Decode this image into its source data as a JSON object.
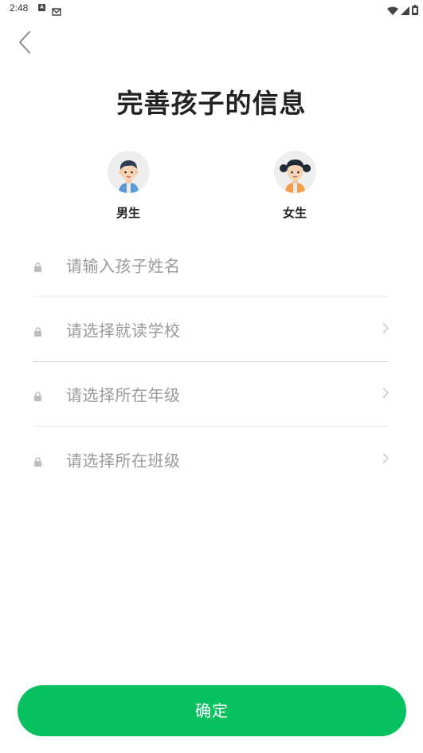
{
  "status_bar": {
    "time": "2:48",
    "badge_letter": "A",
    "icons": [
      "a-badge-icon",
      "mail-icon",
      "wifi-icon",
      "signal-icon",
      "battery-icon"
    ]
  },
  "header": {
    "back_icon": "chevron-left-icon",
    "title": "完善孩子的信息"
  },
  "gender": {
    "options": [
      {
        "label": "男生",
        "avatar": "boy-avatar-icon"
      },
      {
        "label": "女生",
        "avatar": "girl-avatar-icon"
      }
    ]
  },
  "form": {
    "fields": [
      {
        "placeholder": "请输入孩子姓名",
        "icon": "lock-icon",
        "has_chevron": false
      },
      {
        "placeholder": "请选择就读学校",
        "icon": "lock-icon",
        "has_chevron": true
      },
      {
        "placeholder": "请选择所在年级",
        "icon": "lock-icon",
        "has_chevron": true
      },
      {
        "placeholder": "请选择所在班级",
        "icon": "lock-icon",
        "has_chevron": true
      }
    ]
  },
  "footer": {
    "confirm_label": "确定"
  },
  "colors": {
    "accent": "#07c160",
    "placeholder": "#9a9a9a",
    "title": "#222222"
  }
}
